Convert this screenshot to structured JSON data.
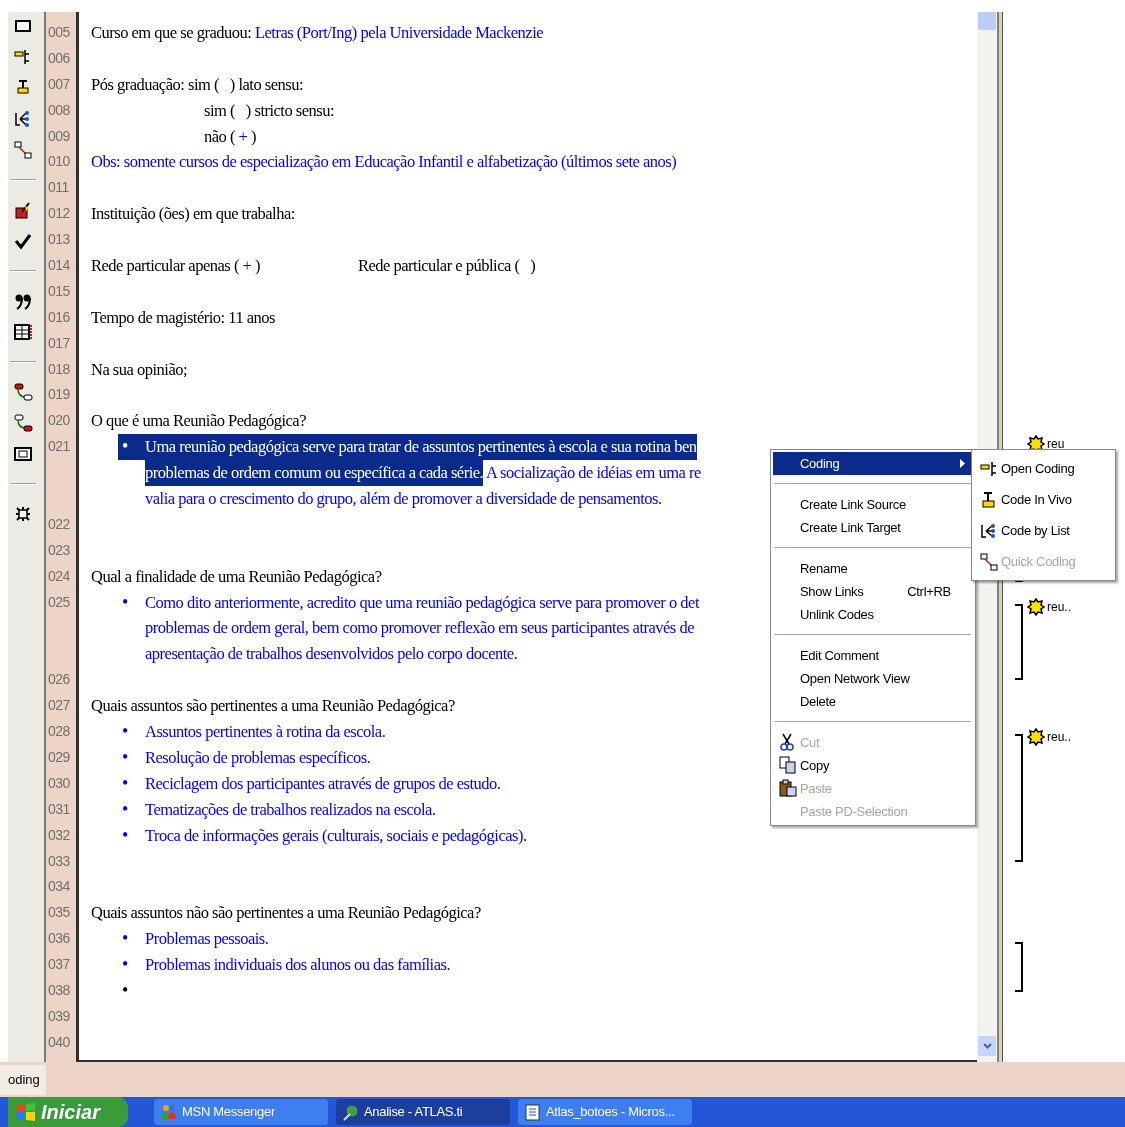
{
  "document": {
    "lines": [
      {
        "number": "005",
        "kind": "plain",
        "segments": [
          {
            "text": "Curso em que se graduou: ",
            "coded": false,
            "selected": false
          },
          {
            "text": "Letras (Port/Ing) pela Universidade Mackenzie",
            "coded": true,
            "selected": false
          }
        ]
      },
      {
        "number": "006",
        "kind": "plain"
      },
      {
        "number": "007",
        "kind": "plain",
        "segments": [
          {
            "text": "Pós graduação: sim (   ) lato sensu:",
            "coded": false,
            "selected": false
          }
        ]
      },
      {
        "number": "008",
        "kind": "indented",
        "segments": [
          {
            "text": "sim (   ) stricto sensu:",
            "coded": false,
            "selected": false
          }
        ]
      },
      {
        "number": "009",
        "kind": "indented",
        "segments": [
          {
            "text": "não ( ",
            "coded": false,
            "selected": false
          },
          {
            "text": "+",
            "coded": true,
            "selected": false
          },
          {
            "text": " )",
            "coded": false,
            "selected": false
          }
        ]
      },
      {
        "number": "010",
        "kind": "plain",
        "segments": [
          {
            "text": "Obs: somente cursos de especialização em Educação Infantil e alfabetização (últimos sete anos)",
            "coded": true,
            "selected": false
          }
        ]
      },
      {
        "number": "011",
        "kind": "plain"
      },
      {
        "number": "012",
        "kind": "plain",
        "segments": [
          {
            "text": "Instituição (ões) em que trabalha:",
            "coded": false,
            "selected": false
          }
        ]
      },
      {
        "number": "013",
        "kind": "plain"
      },
      {
        "number": "014",
        "kind": "plain",
        "segments": [
          {
            "text": "Rede particular apenas ( ",
            "coded": false,
            "selected": false
          },
          {
            "text": "+",
            "coded": true,
            "selected": false
          },
          {
            "text": " )",
            "coded": false,
            "selected": false
          }
        ],
        "second_column": [
          {
            "text": "Rede particular e pública (   )",
            "coded": false,
            "selected": false
          }
        ]
      },
      {
        "number": "015",
        "kind": "plain"
      },
      {
        "number": "016",
        "kind": "plain",
        "segments": [
          {
            "text": "Tempo de magistério: 11 anos",
            "coded": false,
            "selected": false
          }
        ]
      },
      {
        "number": "017",
        "kind": "plain"
      },
      {
        "number": "018",
        "kind": "plain",
        "segments": [
          {
            "text": "Na sua opinião;",
            "coded": false,
            "selected": false
          }
        ]
      },
      {
        "number": "019",
        "kind": "plain"
      },
      {
        "number": "020",
        "kind": "plain",
        "segments": [
          {
            "text": "O que é uma Reunião Pedagógica?",
            "coded": false,
            "selected": false
          }
        ]
      },
      {
        "number": "021",
        "kind": "bullet",
        "bullet": {
          "text": "•",
          "selected": true
        },
        "segments": [
          {
            "text": "Uma reunião pedagógica serve para tratar de assuntos pertinentes à escola e sua rotina ben",
            "selected": true
          }
        ]
      },
      {
        "kind": "wrap",
        "segments": [
          {
            "text": "problemas de ordem comum ou específica a cada série.",
            "selected": true
          },
          {
            "text": " A socialização de idéias em uma re",
            "coded": true,
            "selected": false
          }
        ]
      },
      {
        "kind": "wrap",
        "segments": [
          {
            "text": "valia para o crescimento do grupo, além de promover a diversidade de pensamentos.",
            "coded": true,
            "selected": false
          }
        ]
      },
      {
        "number": "022",
        "kind": "plain"
      },
      {
        "number": "023",
        "kind": "plain"
      },
      {
        "number": "024",
        "kind": "plain",
        "segments": [
          {
            "text": "Qual a finalidade de uma Reunião Pedagógica?",
            "coded": false,
            "selected": false
          }
        ]
      },
      {
        "number": "025",
        "kind": "bullet",
        "bullet": {
          "text": "•",
          "coded": true,
          "selected": false
        },
        "segments": [
          {
            "text": "Como dito anteriormente, acredito que uma reunião pedagógica serve para promover o det",
            "coded": true,
            "selected": false
          }
        ]
      },
      {
        "kind": "wrap",
        "segments": [
          {
            "text": "problemas de ordem geral, bem como promover reflexão em seus participantes através de",
            "coded": true,
            "selected": false
          }
        ]
      },
      {
        "kind": "wrap",
        "segments": [
          {
            "text": "apresentação de trabalhos desenvolvidos pelo corpo docente.",
            "coded": true,
            "selected": false
          }
        ]
      },
      {
        "number": "026",
        "kind": "plain"
      },
      {
        "number": "027",
        "kind": "plain",
        "segments": [
          {
            "text": "Quais assuntos são pertinentes a uma Reunião Pedagógica?",
            "coded": false,
            "selected": false
          }
        ]
      },
      {
        "number": "028",
        "kind": "bullet",
        "bullet": {
          "text": "•",
          "coded": true,
          "selected": false
        },
        "segments": [
          {
            "text": "Assuntos pertinentes à rotina da escola.",
            "coded": true,
            "selected": false
          }
        ]
      },
      {
        "number": "029",
        "kind": "bullet",
        "bullet": {
          "text": "•",
          "coded": true,
          "selected": false
        },
        "segments": [
          {
            "text": "Resolução de problemas específicos.",
            "coded": true,
            "selected": false
          }
        ]
      },
      {
        "number": "030",
        "kind": "bullet",
        "bullet": {
          "text": "•",
          "coded": true,
          "selected": false
        },
        "segments": [
          {
            "text": "Reciclagem dos participantes através de grupos de estudo.",
            "coded": true,
            "selected": false
          }
        ]
      },
      {
        "number": "031",
        "kind": "bullet",
        "bullet": {
          "text": "•",
          "coded": true,
          "selected": false
        },
        "segments": [
          {
            "text": "Tematizações de trabalhos realizados na escola.",
            "coded": true,
            "selected": false
          }
        ]
      },
      {
        "number": "032",
        "kind": "bullet",
        "bullet": {
          "text": "•",
          "coded": true,
          "selected": false
        },
        "segments": [
          {
            "text": "Troca de informações gerais (culturais, sociais e pedagógicas).",
            "coded": true,
            "selected": false
          }
        ]
      },
      {
        "number": "033",
        "kind": "plain"
      },
      {
        "number": "034",
        "kind": "plain"
      },
      {
        "number": "035",
        "kind": "plain",
        "segments": [
          {
            "text": "Quais assuntos não são pertinentes a uma Reunião Pedagógica?",
            "coded": false,
            "selected": false
          }
        ]
      },
      {
        "number": "036",
        "kind": "bullet",
        "bullet": {
          "text": "•",
          "coded": true,
          "selected": false
        },
        "segments": [
          {
            "text": "Problemas pessoais.",
            "coded": true,
            "selected": false
          }
        ]
      },
      {
        "number": "037",
        "kind": "bullet",
        "bullet": {
          "text": "•",
          "coded": true,
          "selected": false
        },
        "segments": [
          {
            "text": "Problemas individuais dos alunos ou das famílias.",
            "coded": true,
            "selected": false
          }
        ]
      },
      {
        "number": "038",
        "kind": "bullet",
        "bullet": {
          "text": "•",
          "coded": false,
          "selected": false
        }
      },
      {
        "number": "039",
        "kind": "plain"
      },
      {
        "number": "040",
        "kind": "plain"
      }
    ]
  },
  "margin_codes": [
    {
      "label": "reu"
    },
    {
      "label": "reu.."
    },
    {
      "label": "reu.."
    }
  ],
  "context_menu": {
    "items": [
      {
        "kind": "item",
        "label": "Coding",
        "selected": true,
        "disabled": false,
        "has_submenu": true
      },
      {
        "kind": "separator"
      },
      {
        "kind": "item",
        "label": "Create Link Source",
        "selected": false,
        "disabled": false,
        "has_submenu": false
      },
      {
        "kind": "item",
        "label": "Create Link Target",
        "selected": false,
        "disabled": false,
        "has_submenu": false
      },
      {
        "kind": "separator"
      },
      {
        "kind": "item",
        "label": "Rename",
        "selected": false,
        "disabled": false,
        "has_submenu": false
      },
      {
        "kind": "item",
        "label": "Show Links",
        "shortcut": "Ctrl+RB",
        "selected": false,
        "disabled": false,
        "has_submenu": false
      },
      {
        "kind": "item",
        "label": "Unlink Codes",
        "selected": false,
        "disabled": false,
        "has_submenu": false
      },
      {
        "kind": "separator"
      },
      {
        "kind": "item",
        "label": "Edit Comment",
        "selected": false,
        "disabled": false,
        "has_submenu": false
      },
      {
        "kind": "item",
        "label": "Open Network View",
        "selected": false,
        "disabled": false,
        "has_submenu": false
      },
      {
        "kind": "item",
        "label": "Delete",
        "selected": false,
        "disabled": false,
        "has_submenu": false
      },
      {
        "kind": "separator"
      },
      {
        "kind": "item",
        "label": "Cut",
        "selected": false,
        "disabled": true,
        "has_submenu": false
      },
      {
        "kind": "item",
        "label": "Copy",
        "selected": false,
        "disabled": false,
        "has_submenu": false
      },
      {
        "kind": "item",
        "label": "Paste",
        "selected": false,
        "disabled": true,
        "has_submenu": false
      },
      {
        "kind": "item",
        "label": "Paste PD-Selection",
        "selected": false,
        "disabled": true,
        "has_submenu": false
      }
    ]
  },
  "submenu": {
    "items": [
      {
        "label": "Open Coding",
        "disabled": false
      },
      {
        "label": "Code In Vivo",
        "disabled": false
      },
      {
        "label": "Code by List",
        "disabled": false
      },
      {
        "label": "Quick Coding",
        "disabled": true
      }
    ]
  },
  "status_bar": {
    "text": "oding"
  },
  "taskbar": {
    "start": "Iniciar",
    "buttons": [
      {
        "label": "MSN Messenger",
        "selected": false
      },
      {
        "label": "Analise - ATLAS.ti",
        "selected": true
      },
      {
        "label": "Atlas_botoes - Micros...",
        "selected": false
      }
    ]
  }
}
